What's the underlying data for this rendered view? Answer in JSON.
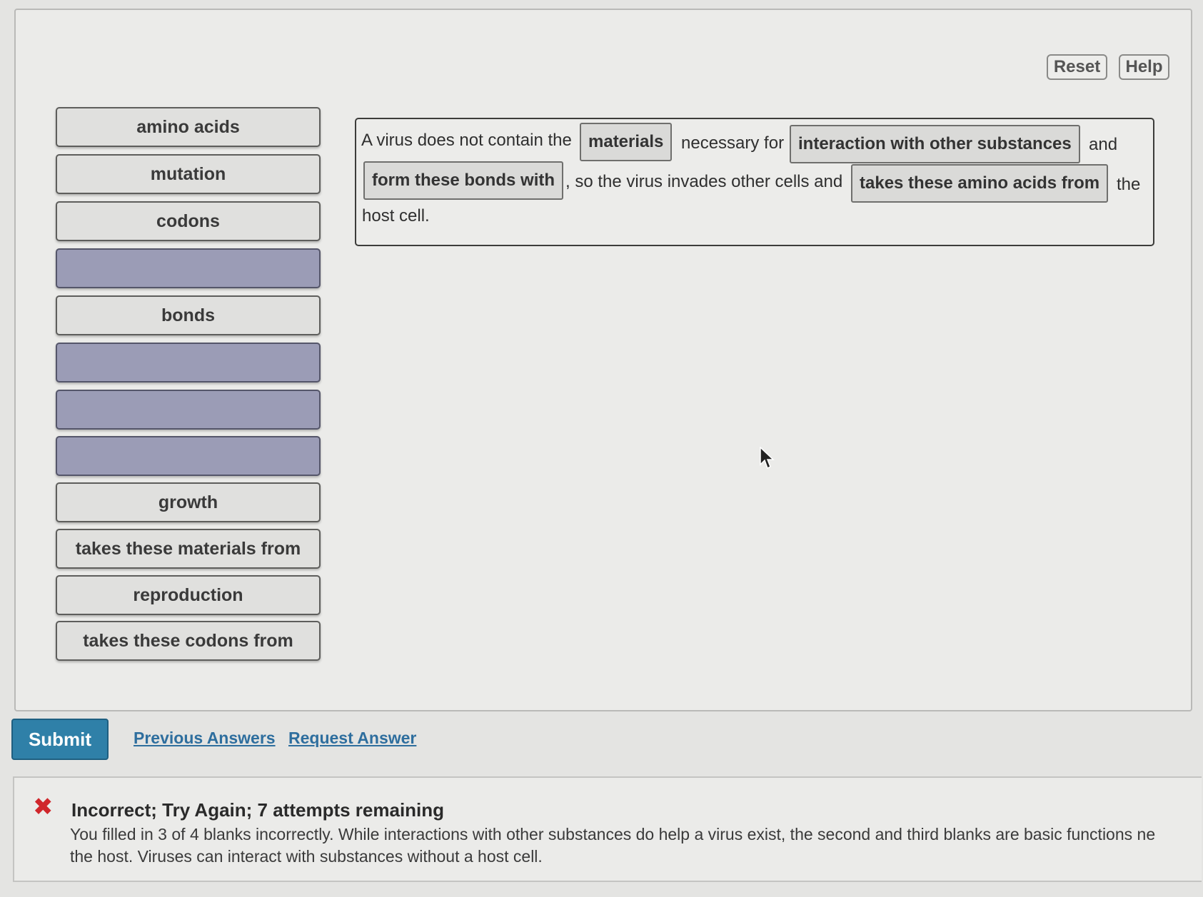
{
  "toolbar": {
    "reset_label": "Reset",
    "help_label": "Help"
  },
  "bank": {
    "items": [
      {
        "label": "amino acids",
        "state": "filled"
      },
      {
        "label": "mutation",
        "state": "filled"
      },
      {
        "label": "codons",
        "state": "filled"
      },
      {
        "label": "",
        "state": "empty"
      },
      {
        "label": "bonds",
        "state": "filled"
      },
      {
        "label": "",
        "state": "empty"
      },
      {
        "label": "",
        "state": "empty"
      },
      {
        "label": "",
        "state": "empty"
      },
      {
        "label": "growth",
        "state": "filled"
      },
      {
        "label": "takes these materials from",
        "state": "filled"
      },
      {
        "label": "reproduction",
        "state": "filled"
      },
      {
        "label": "takes these codons from",
        "state": "filled"
      }
    ]
  },
  "sentence": {
    "part1": "A virus does not contain the",
    "blank1": "materials",
    "part2": "necessary for",
    "blank2": "interaction with other substances",
    "part3": "and",
    "blank3": "form these bonds with",
    "part4": ", so the virus invades other cells and",
    "blank4": "takes these amino acids from",
    "part5": "the",
    "part6": "host cell."
  },
  "actions": {
    "submit_label": "Submit",
    "previous_answers_label": "Previous Answers",
    "request_answer_label": "Request Answer"
  },
  "feedback": {
    "title": "Incorrect; Try Again; 7 attempts remaining",
    "line1": "You filled in 3 of 4 blanks incorrectly. While interactions with other substances do help a virus exist, the second and third blanks are basic functions ne",
    "line2": "the host. Viruses can interact with substances without a host cell.",
    "icon": "x-icon",
    "icon_color": "#d0262b"
  },
  "colors": {
    "accent": "#2f80a8",
    "link": "#2e6e9e",
    "empty_slot": "#9b9cb6"
  }
}
